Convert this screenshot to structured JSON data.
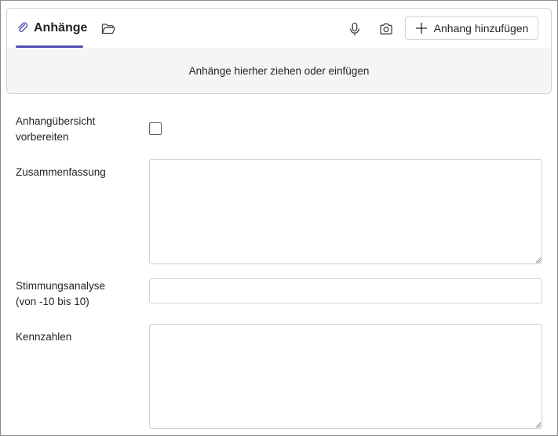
{
  "attachments": {
    "tab_label": "Anhänge",
    "add_button_label": "Anhang hinzufügen",
    "drop_hint": "Anhänge hierher ziehen oder einfügen",
    "accent_color": "#4f52b2",
    "icons": {
      "tab": "paperclip-icon",
      "folder": "folder-open-icon",
      "mic": "microphone-icon",
      "camera": "camera-icon",
      "add": "plus-icon"
    }
  },
  "form": {
    "overview": {
      "label_line1": "Anhangübersicht",
      "label_line2": "vorbereiten",
      "checked": false
    },
    "summary": {
      "label": "Zusammenfassung",
      "value": ""
    },
    "sentiment": {
      "label_line1": "Stimmungsanalyse",
      "label_line2": "(von -10 bis 10)",
      "value": ""
    },
    "metrics": {
      "label": "Kennzahlen",
      "value": ""
    }
  }
}
